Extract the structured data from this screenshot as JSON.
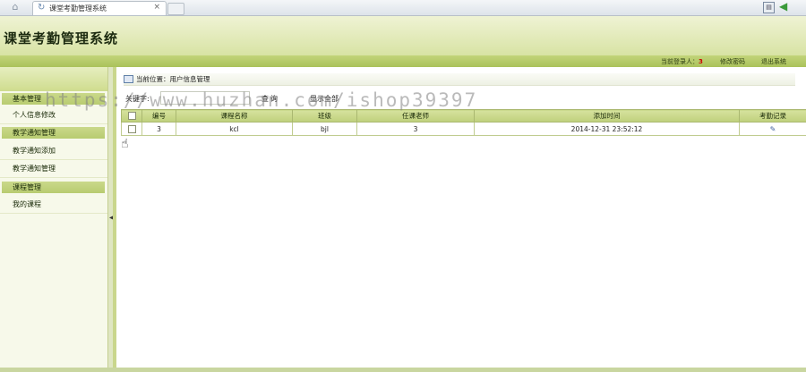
{
  "browser": {
    "home_icon": "home-icon",
    "tab_title": "课堂考勤管理系统",
    "tab_close": "×"
  },
  "header": {
    "title": "课堂考勤管理系统"
  },
  "topbar": {
    "login_label": "当前登录人：",
    "login_user": "3",
    "change_password": "修改密码",
    "logout": "退出系统"
  },
  "sidebar": {
    "groups": [
      {
        "label": "基本管理",
        "items": [
          {
            "label": "个人信息修改"
          }
        ]
      },
      {
        "label": "教学通知管理",
        "items": [
          {
            "label": "教学通知添加"
          },
          {
            "label": "教学通知管理"
          }
        ]
      },
      {
        "label": "课程管理",
        "items": [
          {
            "label": "我的课程"
          }
        ]
      }
    ]
  },
  "content": {
    "location": "当前位置：用户信息管理",
    "search": {
      "label": "关键字:",
      "value": "",
      "button": "查询",
      "show_all": "显示全部"
    },
    "table": {
      "headers": [
        "",
        "编号",
        "课程名称",
        "班级",
        "任课老师",
        "添加时间",
        "考勤记录"
      ],
      "rows": [
        {
          "id": "3",
          "course": "kcl",
          "class": "bjl",
          "teacher": "3",
          "added": "2014-12-31 23:52:12"
        }
      ]
    }
  },
  "watermark": "https://www.huzhan.com/ishop39397",
  "colors": {
    "header_green": "#d8e3a4",
    "bar_green": "#b8cc70",
    "user_red": "#cc0000"
  }
}
